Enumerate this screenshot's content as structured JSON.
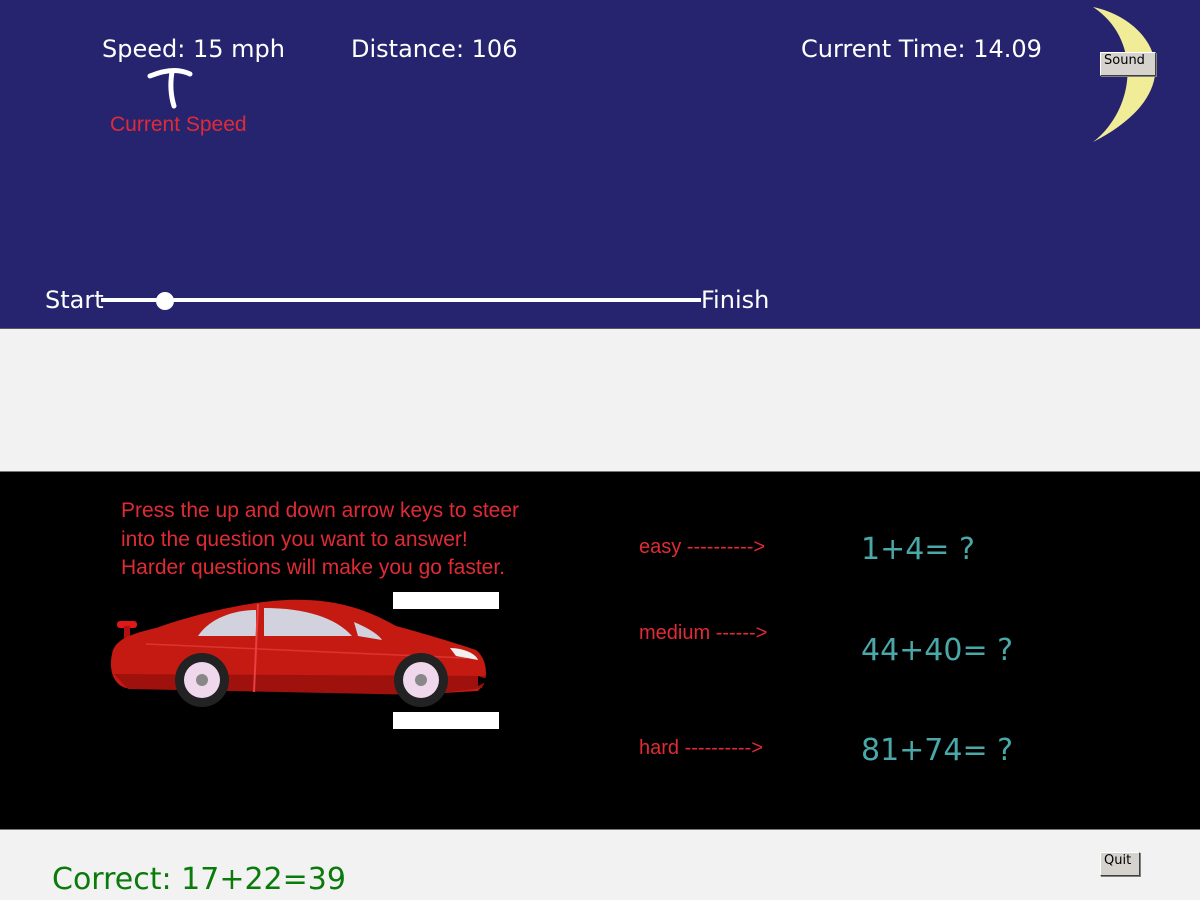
{
  "hud": {
    "speed": "Speed: 15 mph",
    "distance": "Distance: 106",
    "time": "Current Time: 14.09",
    "speed_annotation": "Current Speed"
  },
  "buttons": {
    "sound": "Sound",
    "quit": "Quit"
  },
  "progress": {
    "start_label": "Start",
    "finish_label": "Finish",
    "fraction": 0.107
  },
  "instructions": [
    "Press the up and down arrow keys to steer",
    "into the question you want to answer!",
    "Harder questions will make you go faster."
  ],
  "questions": {
    "easy": {
      "label": "easy   ---------->",
      "question": "1+4= ?"
    },
    "medium": {
      "label": "medium ------>",
      "question": "44+40= ?"
    },
    "hard": {
      "label": "hard ---------->",
      "question": "81+74= ?"
    }
  },
  "feedback": "Correct: 17+22=39",
  "colors": {
    "sky": "#26246e",
    "moon": "#f0ec98",
    "annotation": "#e02b36",
    "question": "#4aa8a8",
    "correct": "#0a7a0a",
    "car": "#c41a12"
  },
  "icons": {
    "moon": "crescent-moon-icon",
    "arrow": "up-arrow-icon",
    "car": "red-sports-car"
  }
}
